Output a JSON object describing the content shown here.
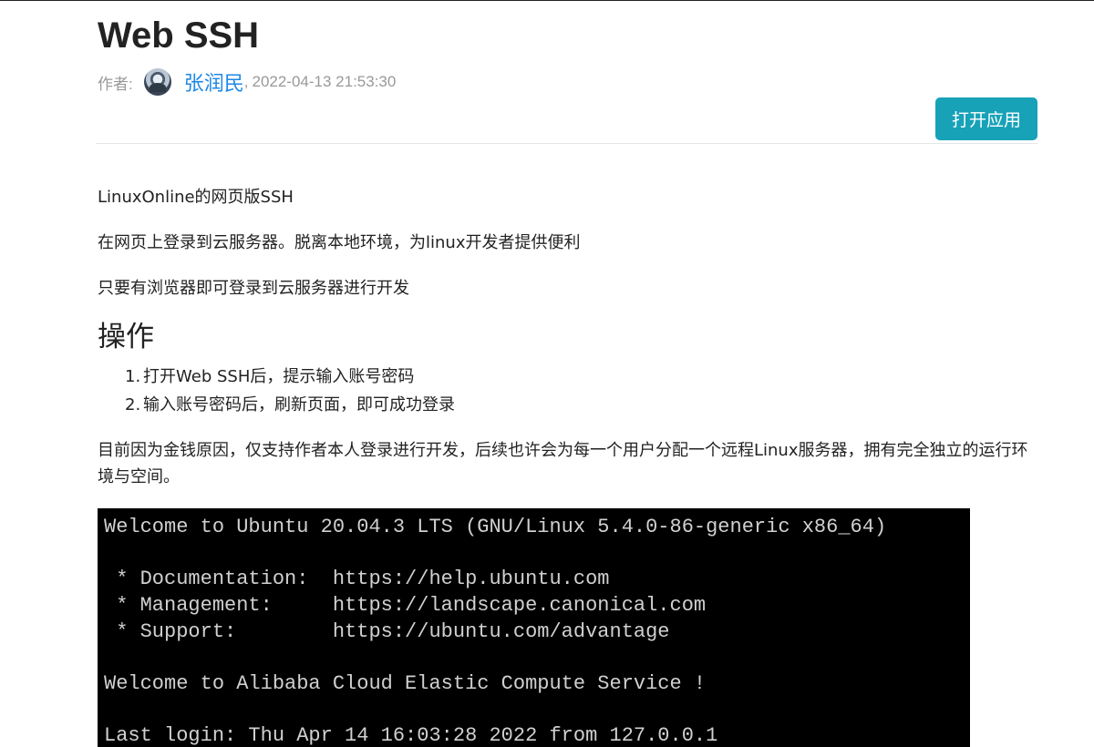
{
  "article": {
    "title": "Web SSH",
    "author_label": "作者:",
    "author_name": "张润民",
    "date_sep": ",",
    "date": "2022-04-13 21:53:30",
    "open_button": "打开应用"
  },
  "content": {
    "p1": "LinuxOnline的网页版SSH",
    "p2": "在网页上登录到云服务器。脱离本地环境，为linux开发者提供便利",
    "p3": "只要有浏览器即可登录到云服务器进行开发",
    "heading": "操作",
    "steps": [
      {
        "num": "1.",
        "text": "打开Web SSH后，提示输入账号密码"
      },
      {
        "num": "2.",
        "text": "输入账号密码后，刷新页面，即可成功登录"
      }
    ],
    "p4": "目前因为金钱原因，仅支持作者本人登录进行开发，后续也许会为每一个用户分配一个远程Linux服务器，拥有完全独立的运行环境与空间。"
  },
  "terminal": {
    "lines": [
      "Welcome to Ubuntu 20.04.3 LTS (GNU/Linux 5.4.0-86-generic x86_64)",
      "",
      " * Documentation:  https://help.ubuntu.com",
      " * Management:     https://landscape.canonical.com",
      " * Support:        https://ubuntu.com/advantage",
      "",
      "Welcome to Alibaba Cloud Elastic Compute Service !",
      "",
      "Last login: Thu Apr 14 16:03:28 2022 from 127.0.0.1"
    ]
  },
  "colors": {
    "accent": "#17a2b8",
    "author_link": "#1e88e5",
    "muted": "#999999"
  }
}
